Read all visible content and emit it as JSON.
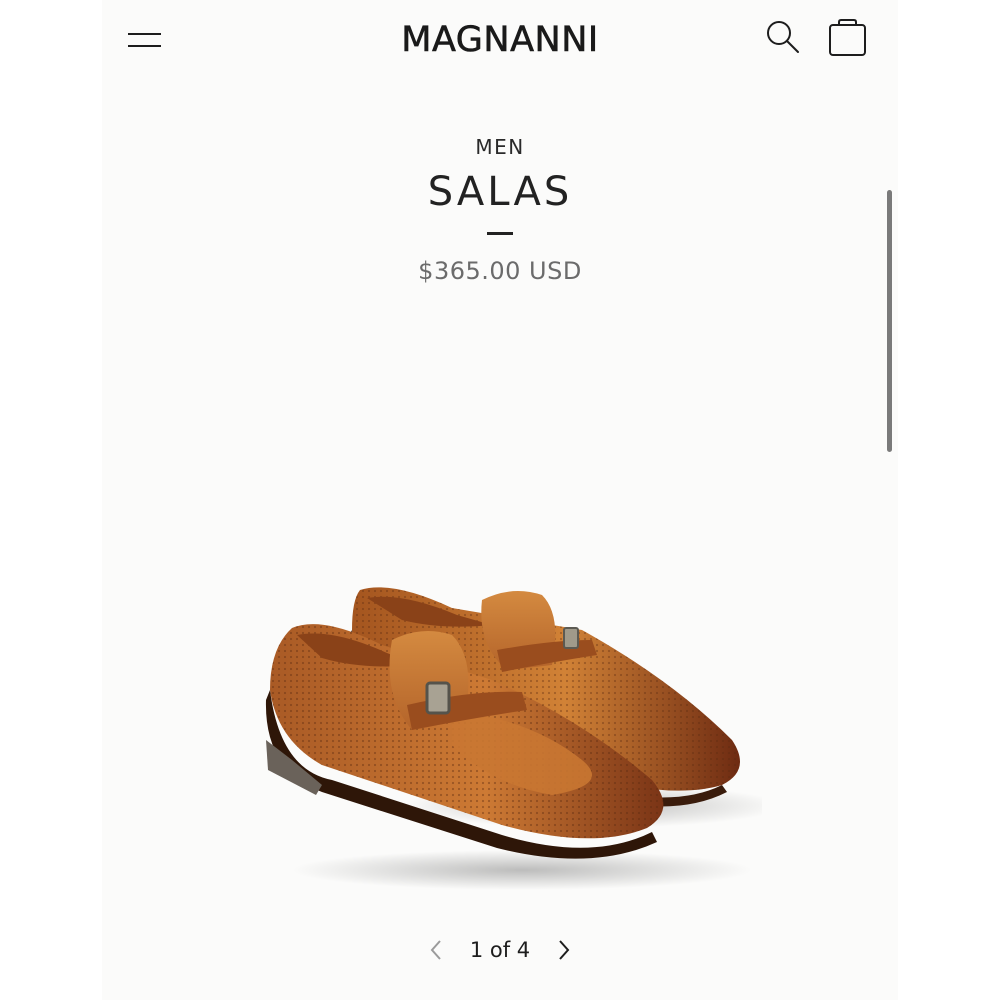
{
  "header": {
    "brand": "MAGNANNI",
    "menu_icon": "hamburger-menu-icon",
    "search_icon": "search-icon",
    "cart_icon": "shopping-bag-icon"
  },
  "product": {
    "category": "MEN",
    "name": "SALAS",
    "price": "$365.00 USD",
    "image_alt": "Cognac perforated leather bit loafers",
    "leather_color": "#b8652a"
  },
  "gallery": {
    "pager_text": "1 of 4",
    "prev_icon": "chevron-left-icon",
    "next_icon": "chevron-right-icon"
  },
  "colors": {
    "background": "#fbfbfa",
    "text": "#1a1a1a",
    "price_text": "#6b6b6b"
  }
}
